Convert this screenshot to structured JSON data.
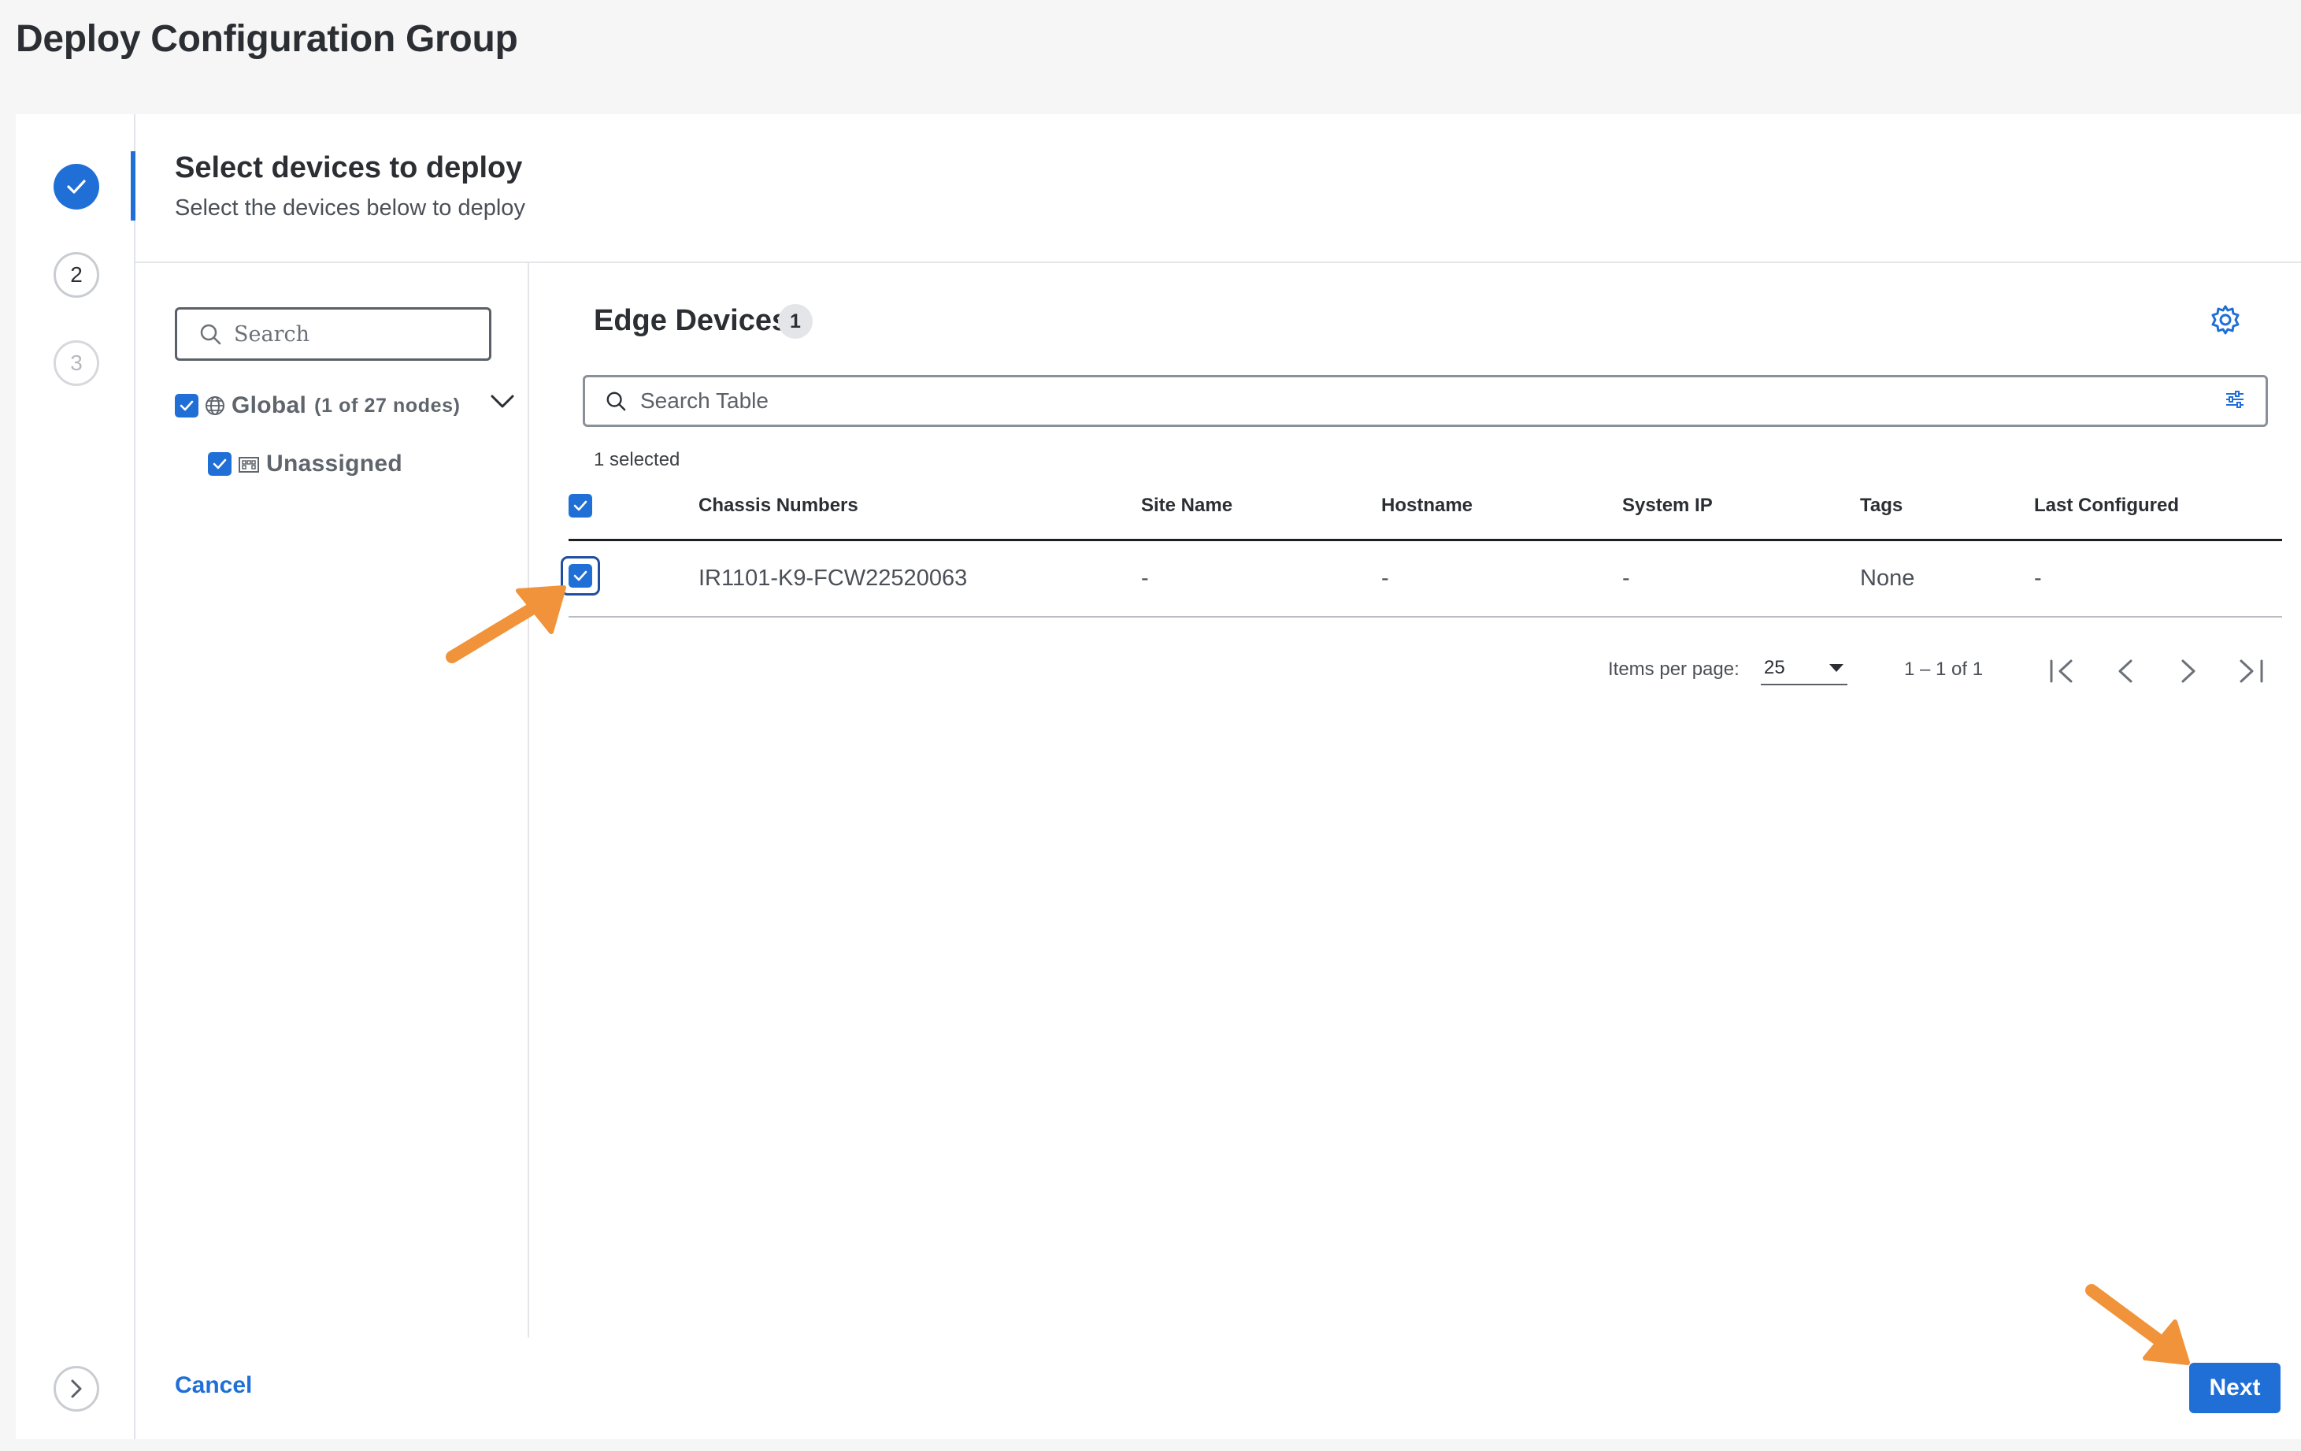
{
  "page": {
    "title": "Deploy Configuration Group"
  },
  "stepper": {
    "steps": [
      {
        "label": "",
        "state": "complete"
      },
      {
        "label": "2",
        "state": "pending"
      },
      {
        "label": "3",
        "state": "disabled"
      }
    ]
  },
  "section": {
    "title": "Select devices to deploy",
    "subtitle": "Select the devices below to deploy"
  },
  "tree": {
    "search_placeholder": "Search",
    "global": {
      "label": "Global",
      "count": "(1 of 27 nodes)",
      "checked": true
    },
    "unassigned": {
      "label": "Unassigned",
      "checked": true
    }
  },
  "table": {
    "title": "Edge Devices",
    "count": "1",
    "search_placeholder": "Search Table",
    "selected_text": "1 selected",
    "columns": [
      "Chassis Numbers",
      "Site Name",
      "Hostname",
      "System IP",
      "Tags",
      "Last Configured"
    ],
    "rows": [
      {
        "checked": true,
        "cells": [
          "IR1101-K9-FCW22520063",
          "-",
          "-",
          "-",
          "None",
          "-"
        ]
      }
    ]
  },
  "pagination": {
    "items_per_page_label": "Items per page:",
    "items_per_page_value": "25",
    "range": "1 – 1 of 1"
  },
  "footer": {
    "cancel_label": "Cancel",
    "next_label": "Next"
  },
  "colors": {
    "accent": "#1f6fd6",
    "annotation_arrow": "#f0933a"
  }
}
